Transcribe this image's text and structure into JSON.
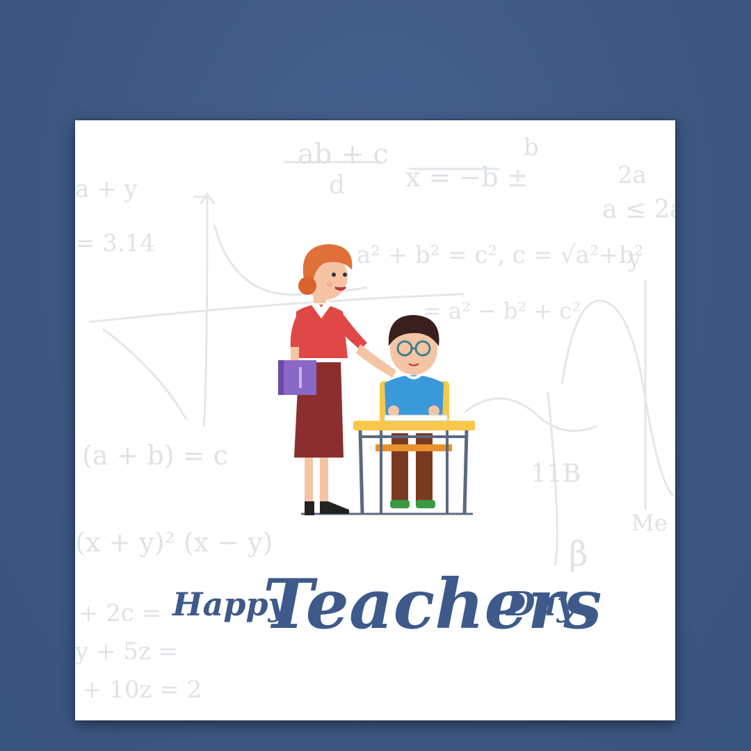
{
  "greeting": {
    "word1": "Happy",
    "word2": "Teachers",
    "word3": "Day"
  },
  "background_formulas": [
    "ab + c",
    "d",
    "x = −b ±",
    "b",
    "2a",
    "a + y",
    "a ≤ 2a",
    "= 3.14",
    "a² + b² = c², c = √a²+b²",
    "= a² − b² + c²",
    "(a + b) = c",
    "(x + y)² (x − y)",
    "11B",
    "β",
    "+ 2c =",
    "y + 5z =",
    "+ 10z = 2",
    "Me",
    "y"
  ],
  "colors": {
    "background": "#3e5781",
    "card": "#ffffff",
    "text_brand": "#3e5a8a",
    "teacher_hair": "#e0703a",
    "teacher_top": "#e04848",
    "teacher_skirt": "#8a2e2e",
    "book": "#7c5bb8",
    "student_shirt": "#3a9ad9",
    "desk_top": "#f7c84b",
    "desk_legs": "#5a6a82"
  },
  "icons": [
    "teacher-figure",
    "student-figure",
    "desk",
    "book"
  ]
}
